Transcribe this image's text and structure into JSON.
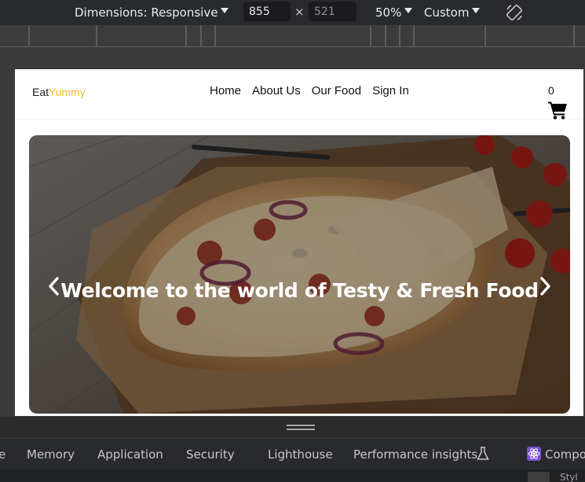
{
  "toolbar": {
    "dimensions_label": "Dimensions: Responsive",
    "width_value": "855",
    "times_symbol": "×",
    "height_value": "521",
    "zoom": "50%",
    "throttle": "Custom",
    "rotate_icon": "rotate-icon"
  },
  "site": {
    "brand_prefix": "Eat",
    "brand_accent": "Yummy",
    "brand_accent_color": "#f5b82e",
    "nav": [
      "Home",
      "About Us",
      "Our Food",
      "Sign In"
    ],
    "cart_count": "0",
    "cart_icon": "shopping-cart-icon",
    "hero_title": "Welcome to the world of Testy & Fresh Food",
    "prev_icon": "chevron-left-icon",
    "next_icon": "chevron-right-icon"
  },
  "devtools": {
    "tabs": [
      "e",
      "Memory",
      "Application",
      "Security",
      "Lighthouse",
      "Performance insights",
      "Compo"
    ],
    "styles_label": "Styl"
  }
}
